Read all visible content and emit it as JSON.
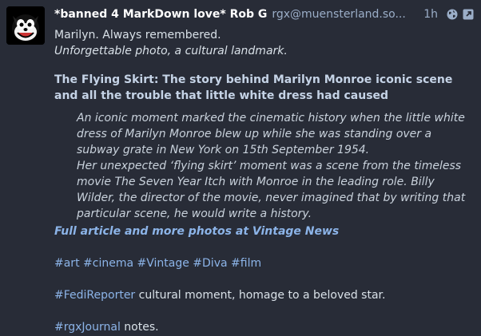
{
  "header": {
    "display_name": "*banned 4 MarkDown love* Rob G",
    "acct": "rgx@muensterland.so...",
    "time": "1h"
  },
  "post": {
    "line1": "Marilyn. Always remembered.",
    "line2": "Unforgettable photo, a cultural landmark.",
    "heading": "The Flying Skirt: The story behind Marilyn Monroe iconic scene and all the trouble that little white dress had caused",
    "quote1": "An iconic moment marked the cinematic history when the little white dress of Marilyn Monroe blew up while she was standing over a subway grate in New York on 15th September 1954.",
    "quote2": "Her unexpected ‘flying skirt’ moment was a scene from the timeless movie The Seven Year Itch with Monroe in the leading role. Billy Wilder, the director of the movie, never imagined that by writing that particular scene, he would write a history.",
    "article_link": "Full article and more photos at Vintage News",
    "tags": [
      "#art",
      "#cinema",
      "#Vintage",
      "#Diva",
      "#film"
    ],
    "fedi_tag": "#FediReporter",
    "fedi_text": " cultural moment, homage to a beloved star.",
    "journal_tag": "#rgxJournal",
    "journal_text": " notes."
  },
  "icons": {
    "globe": "globe-icon",
    "expand": "expand-icon"
  }
}
